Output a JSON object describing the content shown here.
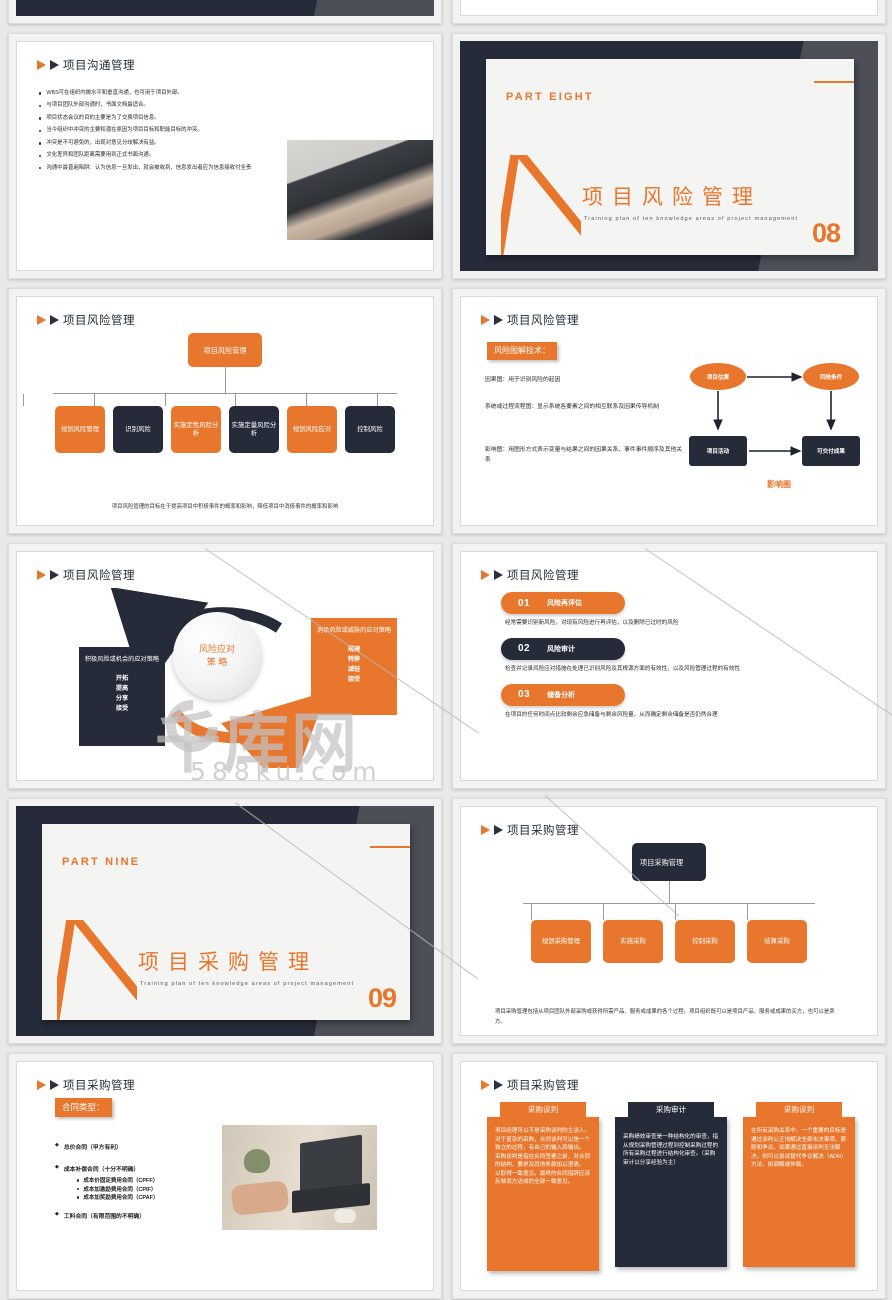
{
  "watermark": {
    "logo": "千库网",
    "domain": "588ku.com"
  },
  "slides": [
    {
      "id": "slide-communication",
      "type": "bullets",
      "header": "项目沟通管理",
      "bullets": [
        "WBS可在组织内做水平和垂直沟通，也可用于项目外部。",
        "与项目团队外部沟通时，书面文档最适合。",
        "项目状态会议的目的主要是为了交换项目信息。",
        "当今组织中冲突的主要和潜在原因为项目目标和职能目标的冲突。",
        "冲突是不可避免的，出现对意见分歧解决有益。",
        "文化差异和团队距离需要用到正式书面沟通。",
        "沟通中最普遍陷阱：认为信息一旦发出，就会被收到，信息发出者应为信息接收付全责"
      ],
      "image_name": "handshake-photo"
    },
    {
      "id": "slide-part-eight",
      "type": "part",
      "label": "PART EIGHT",
      "title_cn": "项目风险管理",
      "subtitle_en": "Training plan of ten knowledge areas of project management",
      "number": "08"
    },
    {
      "id": "slide-risk-org",
      "type": "org",
      "header": "项目风险管理",
      "root": "项目风险管理",
      "children": [
        {
          "label": "规划风险管理",
          "color": "orange"
        },
        {
          "label": "识别风险",
          "color": "dark"
        },
        {
          "label": "实施定性风险分析",
          "color": "orange"
        },
        {
          "label": "实施定量风险分析",
          "color": "dark"
        },
        {
          "label": "规划风险应对",
          "color": "orange"
        },
        {
          "label": "控制风险",
          "color": "dark"
        }
      ],
      "note": "项目风险管理的目标在于提高项目中积极事件的概率和影响，降低项目中消极事件的概率和影响"
    },
    {
      "id": "slide-risk-diagram",
      "type": "riskdiagram",
      "header": "项目风险管理",
      "tag": "风险图解技术：",
      "paragraphs": [
        "因果图：用于识别风险的起因",
        "系统或过程流程图：显示系统各要素之间的相互联系及因果传导机制",
        "影响图：用图形方式表示变量与结果之间的因果关系、事件事件顺序及其他关系"
      ],
      "diagram": {
        "caption": "影响图",
        "nodes": [
          {
            "label": "项目估算",
            "shape": "ellipse"
          },
          {
            "label": "风险条件",
            "shape": "ellipse"
          },
          {
            "label": "项目活动",
            "shape": "rect"
          },
          {
            "label": "可交付成果",
            "shape": "rect"
          }
        ]
      }
    },
    {
      "id": "slide-risk-strategy",
      "type": "strategy",
      "header": "项目风险管理",
      "center": {
        "line1": "风险应对",
        "line2": "策 略"
      },
      "left": {
        "title": "积极风险或机会的应对策略",
        "items": "开拓\n提高\n分享\n接受"
      },
      "right": {
        "title": "消极风险或威胁的应对策略",
        "items": "规避\n转移\n减轻\n接受"
      }
    },
    {
      "id": "slide-risk-control",
      "type": "pills",
      "header": "项目风险管理",
      "items": [
        {
          "num": "01",
          "label": "风险再评估",
          "color": "orange",
          "desc": "经常需要识别新风险，对现有风险进行再评估，以及删除已过时的风险"
        },
        {
          "num": "02",
          "label": "风险审计",
          "color": "dark",
          "desc": "检查并记录风险应对措施在处理已识别风险及其根源方面的有效性，以及风险管理过程的有效性"
        },
        {
          "num": "03",
          "label": "储备分析",
          "color": "orange",
          "desc": "在项目的任何时间点比较剩余应急储备与剩余风险量，从而确定剩余储备是否仍然合理"
        }
      ]
    },
    {
      "id": "slide-part-nine",
      "type": "part",
      "label": "PART NINE",
      "title_cn": "项目采购管理",
      "subtitle_en": "Training plan of ten knowledge areas of project management",
      "number": "09"
    },
    {
      "id": "slide-procurement-org",
      "type": "org",
      "header": "项目采购管理",
      "root": "项目采购管理",
      "root_color": "dark",
      "children": [
        {
          "label": "规划采购管理",
          "color": "orange"
        },
        {
          "label": "实施采购",
          "color": "orange"
        },
        {
          "label": "控制采购",
          "color": "orange"
        },
        {
          "label": "结算采购",
          "color": "orange"
        }
      ],
      "note": "项目采购管理包括从项目团队外部采购或获得所需产品、服务或成果的各个过程。项目组织既可以是项目产品、服务或成果的买方，也可以是卖方。"
    },
    {
      "id": "slide-contract-types",
      "type": "contract",
      "header": "项目采购管理",
      "tag": "合同类型：",
      "items": [
        {
          "level": 1,
          "text": "总价合同（甲方有利）"
        },
        {
          "level": 1,
          "text": "成本补偿合同（十分不明确）"
        },
        {
          "level": 2,
          "text": "成本价固定费用合同（CPFF）"
        },
        {
          "level": 2,
          "text": "成本加激励费用合同（CPIF）"
        },
        {
          "level": 2,
          "text": "成本加奖励费用合同（CPAF）"
        },
        {
          "level": 1,
          "text": "工料合同（有限范围的不明确）"
        }
      ],
      "image_name": "laptop-photo"
    },
    {
      "id": "slide-procurement-cards",
      "type": "cards",
      "header": "项目采购管理",
      "cards": [
        {
          "title": "采购谈判",
          "color": "orange",
          "body": "项目经理可以不是采购谈判的主谈人。\n对于复杂的采购，合同谈判可以是一个独立的过程，有自己的输入和输出。\n采购谈判是指在合同签署之前，对合同的结构、要求及其他条款加以澄清，\n以取得一致意见。最终的合同措辞应该反映双方达成的全部一致意见。"
        },
        {
          "title": "采购审计",
          "color": "dark",
          "body": "采购绩效审查是一种结构化的审查，指从规划采购管理过程到控制采购过程的所有采购过程进行结构化审查。（采购审计以分享经验为主）"
        },
        {
          "title": "采购谈判",
          "color": "orange",
          "body": "在所有采购关系中，一个重要的目标是通过谈判公正地解决全部未决事项、索赔和争议。如果通过直接谈判无法解决，则可以尝试替代争议解决（ADR）方法，如调解或仲裁。"
        }
      ]
    }
  ]
}
